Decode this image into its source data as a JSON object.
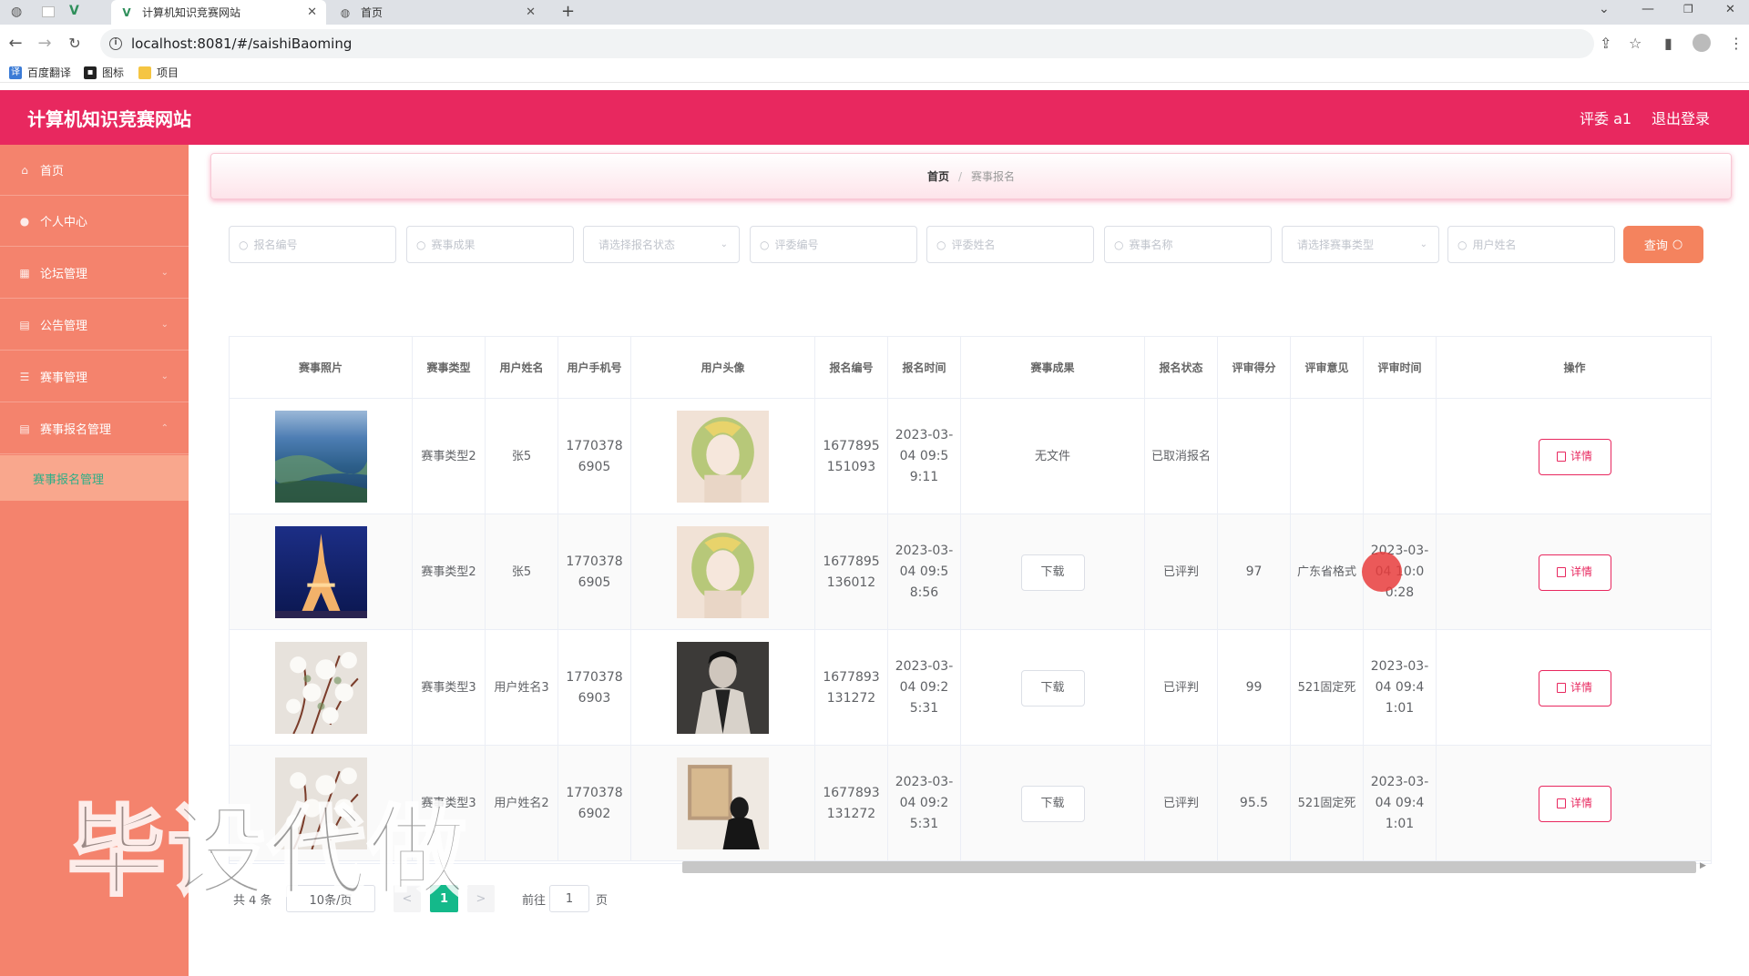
{
  "browser": {
    "tabs": [
      {
        "title": "计算机知识竞赛网站",
        "active": true
      },
      {
        "title": "首页",
        "active": false
      }
    ],
    "new_tab": "+",
    "url": "localhost:8081/#/saishiBaoming",
    "bookmarks": [
      "百度翻译",
      "图标",
      "项目"
    ]
  },
  "header": {
    "site_title": "计算机知识竞赛网站",
    "user": "评委 a1",
    "logout": "退出登录"
  },
  "sidebar": {
    "items": [
      {
        "label": "首页",
        "icon": "home-icon"
      },
      {
        "label": "个人中心",
        "icon": "user-icon"
      },
      {
        "label": "论坛管理",
        "icon": "grid-icon"
      },
      {
        "label": "公告管理",
        "icon": "clipboard-icon"
      },
      {
        "label": "赛事管理",
        "icon": "stack-icon"
      },
      {
        "label": "赛事报名管理",
        "icon": "clipboard-icon"
      }
    ],
    "sub_item": "赛事报名管理"
  },
  "breadcrumb": {
    "home": "首页",
    "separator": "/",
    "current": "赛事报名"
  },
  "search": {
    "fields": [
      {
        "placeholder": "报名编号",
        "type": "input"
      },
      {
        "placeholder": "赛事成果",
        "type": "input"
      },
      {
        "placeholder": "请选择报名状态",
        "type": "select"
      },
      {
        "placeholder": "评委编号",
        "type": "input"
      },
      {
        "placeholder": "评委姓名",
        "type": "input"
      },
      {
        "placeholder": "赛事名称",
        "type": "input"
      },
      {
        "placeholder": "请选择赛事类型",
        "type": "select"
      },
      {
        "placeholder": "用户姓名",
        "type": "input"
      }
    ],
    "query_label": "查询"
  },
  "table": {
    "headers": [
      "赛事照片",
      "赛事类型",
      "用户姓名",
      "用户手机号",
      "用户头像",
      "报名编号",
      "报名时间",
      "赛事成果",
      "报名状态",
      "评审得分",
      "评审意见",
      "评审时间",
      "操作"
    ],
    "rows": [
      {
        "type": "赛事类型2",
        "name": "张5",
        "phone": "17703786905",
        "code": "1677895151093",
        "time": "2023-03-04 09:59:11",
        "result": "无文件",
        "status": "已取消报名",
        "score": "",
        "opinion": "",
        "review_time": "",
        "action": "详情"
      },
      {
        "type": "赛事类型2",
        "name": "张5",
        "phone": "17703786905",
        "code": "1677895136012",
        "time": "2023-03-04 09:58:56",
        "result": "下载",
        "status": "已评判",
        "score": "97",
        "opinion": "广东省格式",
        "review_time": "2023-03-04 10:00:28",
        "action": "详情"
      },
      {
        "type": "赛事类型3",
        "name": "用户姓名3",
        "phone": "17703786903",
        "code": "1677893131272",
        "time": "2023-03-04 09:25:31",
        "result": "下载",
        "status": "已评判",
        "score": "99",
        "opinion": "521固定死",
        "review_time": "2023-03-04 09:41:01",
        "action": "详情"
      },
      {
        "type": "赛事类型3",
        "name": "用户姓名2",
        "phone": "17703786902",
        "code": "1677893131272",
        "time": "2023-03-04 09:25:31",
        "result": "下载",
        "status": "已评判",
        "score": "95.5",
        "opinion": "521固定死",
        "review_time": "2023-03-04 09:41:01",
        "action": "详情"
      }
    ]
  },
  "pagination": {
    "total": "共 4 条",
    "page_size": "10条/页",
    "prev": "<",
    "current": "1",
    "next": ">",
    "goto": "前往",
    "goto_value": "1",
    "page_unit": "页"
  },
  "watermark": "毕设代做",
  "colors": {
    "header": "#e8285f",
    "sidebar": "#f4836d",
    "accent": "#14b98a",
    "query": "#f4835e"
  }
}
